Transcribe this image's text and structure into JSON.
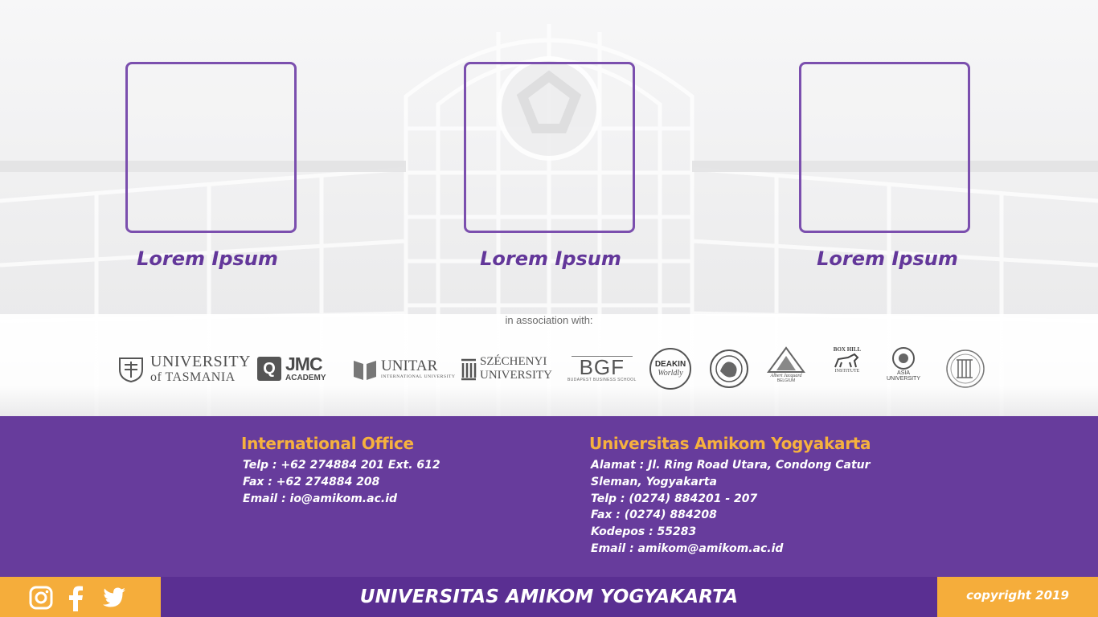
{
  "cards": [
    {
      "label": "Lorem Ipsum"
    },
    {
      "label": "Lorem Ipsum"
    },
    {
      "label": "Lorem Ipsum"
    }
  ],
  "partners": {
    "heading": "in association with:",
    "logos": [
      {
        "name": "University of Tasmania",
        "line1": "UNIVERSITY",
        "line2": "of TASMANIA"
      },
      {
        "name": "JMC Academy",
        "line1": "JMC",
        "line2": "ACADEMY"
      },
      {
        "name": "UNITAR International University",
        "line1": "UNITAR",
        "line2": "INTERNATIONAL UNIVERSITY"
      },
      {
        "name": "Széchenyi István University",
        "line1": "SZÉCHENYI",
        "line2": "UNIVERSITY"
      },
      {
        "name": "Budapest Business School",
        "line1": "BGF",
        "line2": "BUDAPEST BUSINESS SCHOOL"
      },
      {
        "name": "Deakin University",
        "line1": "DEAKIN",
        "line2": "Worldly"
      },
      {
        "name": "Circular seal logo",
        "line1": "",
        "line2": ""
      },
      {
        "name": "Albert Jacquard",
        "line1": "Albert Jacquard",
        "line2": "BELGIUM"
      },
      {
        "name": "Box Hill Institute",
        "line1": "BOX HILL",
        "line2": "INSTITUTE"
      },
      {
        "name": "Asia University",
        "line1": "ASIA",
        "line2": "UNIVERSITY"
      },
      {
        "name": "Round emblem logo",
        "line1": "",
        "line2": ""
      }
    ]
  },
  "international_office": {
    "title": "International Office",
    "lines": [
      "Telp : +62 274884 201 Ext. 612",
      "Fax : +62 274884 208",
      "Email : io@amikom.ac.id"
    ]
  },
  "university": {
    "title": "Universitas Amikom Yogyakarta",
    "lines": [
      "Alamat : Jl. Ring Road Utara, Condong Catur",
      "Sleman, Yogyakarta",
      "Telp : (0274) 884201 - 207",
      "Fax : (0274) 884208",
      "Kodepos : 55283",
      "Email : amikom@amikom.ac.id"
    ]
  },
  "footer": {
    "title": "UNIVERSITAS AMIKOM YOGYAKARTA",
    "copyright": "copyright 2019",
    "social": [
      "instagram-icon",
      "facebook-icon",
      "twitter-icon"
    ]
  },
  "colors": {
    "purple": "#673c9c",
    "purple_dark": "#5a2f92",
    "orange": "#f5ad3b",
    "heading_orange": "#f6b13e",
    "card_border": "#7b4fae",
    "card_label": "#63379a"
  }
}
